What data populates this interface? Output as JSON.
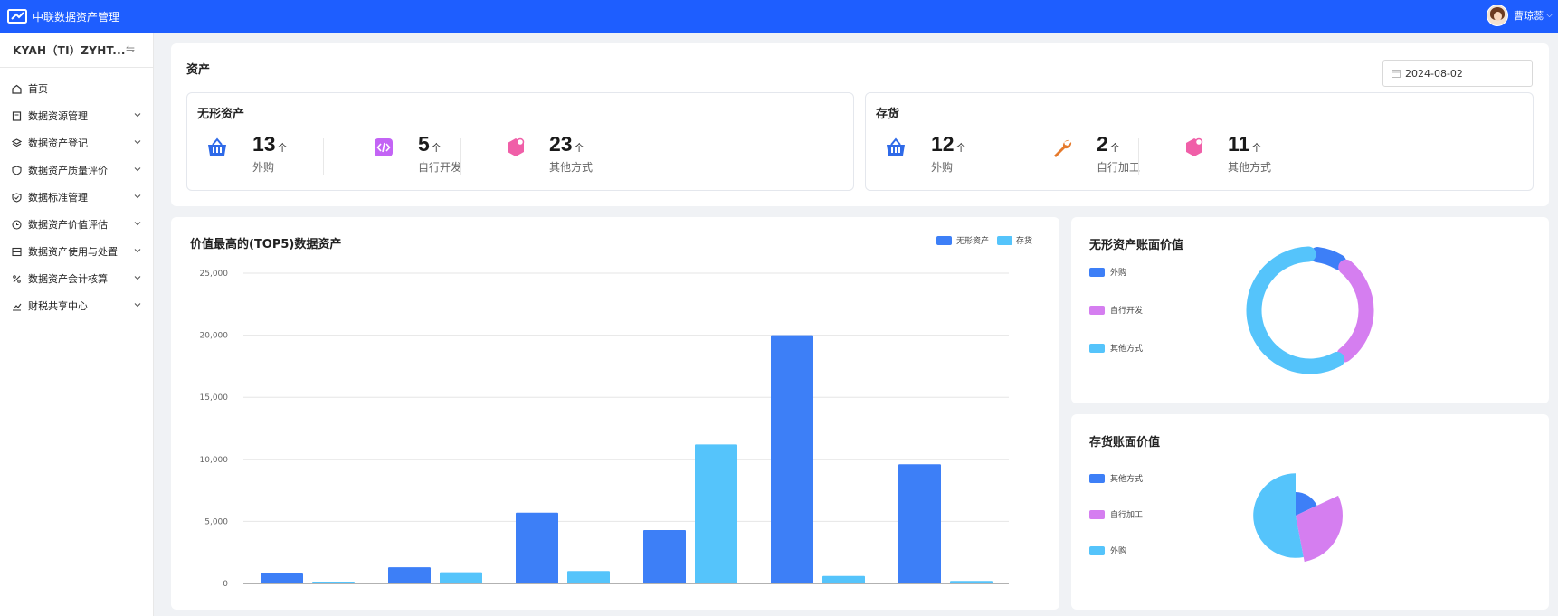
{
  "header": {
    "title": "中联数据资产管理",
    "user_name": "曹琼蕊"
  },
  "sidebar": {
    "org": "KYAH（TI）ZYHT...",
    "items": [
      {
        "label": "首页",
        "icon": "home-icon",
        "has_children": false
      },
      {
        "label": "数据资源管理",
        "icon": "book-icon",
        "has_children": true
      },
      {
        "label": "数据资产登记",
        "icon": "layers-icon",
        "has_children": true
      },
      {
        "label": "数据资产质量评价",
        "icon": "shield-icon",
        "has_children": true
      },
      {
        "label": "数据标准管理",
        "icon": "shield-check-icon",
        "has_children": true
      },
      {
        "label": "数据资产价值评估",
        "icon": "clock-icon",
        "has_children": true
      },
      {
        "label": "数据资产使用与处置",
        "icon": "archive-icon",
        "has_children": true
      },
      {
        "label": "数据资产会计核算",
        "icon": "percent-icon",
        "has_children": true
      },
      {
        "label": "财税共享中心",
        "icon": "chart-icon",
        "has_children": true
      }
    ]
  },
  "assets": {
    "title": "资产",
    "date": "2024-08-02",
    "intangible": {
      "title": "无形资产",
      "stats": [
        {
          "value": "13",
          "unit": "个",
          "label": "外购",
          "icon": "basket-icon",
          "color": "#2f6ae8"
        },
        {
          "value": "5",
          "unit": "个",
          "label": "自行开发",
          "icon": "code-icon",
          "color": "#c364f5"
        },
        {
          "value": "23",
          "unit": "个",
          "label": "其他方式",
          "icon": "hexagon-icon",
          "color": "#f05fa8"
        }
      ]
    },
    "inventory": {
      "title": "存货",
      "stats": [
        {
          "value": "12",
          "unit": "个",
          "label": "外购",
          "icon": "basket-icon",
          "color": "#2f6ae8"
        },
        {
          "value": "2",
          "unit": "个",
          "label": "自行加工",
          "icon": "wrench-icon",
          "color": "#e67a2c"
        },
        {
          "value": "11",
          "unit": "个",
          "label": "其他方式",
          "icon": "hexagon-icon",
          "color": "#f05fa8"
        }
      ]
    }
  },
  "colors": {
    "accent": "#1e5eff",
    "blue": "#3d7ff7",
    "sky": "#55c4fb",
    "purple": "#d57ef0"
  },
  "chart_data": [
    {
      "type": "bar",
      "title": "价值最高的(TOP5)数据资产",
      "categories": [
        "",
        "",
        "",
        "",
        "",
        ""
      ],
      "series": [
        {
          "name": "无形资产",
          "values": [
            800,
            1300,
            5700,
            4300,
            20000,
            9600
          ]
        },
        {
          "name": "存货",
          "values": [
            150,
            900,
            1000,
            11200,
            600,
            200
          ]
        }
      ],
      "yticks": [
        "0",
        "5,000",
        "10,000",
        "15,000",
        "20,000",
        "25,000"
      ],
      "ylim": [
        0,
        25000
      ],
      "grid": true,
      "legend": "top-right"
    },
    {
      "type": "pie",
      "variant": "donut",
      "title": "无形资产账面价值",
      "labels": [
        "外购",
        "自行开发",
        "其他方式"
      ],
      "values": [
        9,
        31,
        60
      ],
      "legend": "left"
    },
    {
      "type": "pie",
      "variant": "rose",
      "title": "存货账面价值",
      "labels": [
        "其他方式",
        "自行加工",
        "外购"
      ],
      "values": [
        18,
        29,
        53
      ],
      "radii": [
        0.5,
        1.0,
        0.9
      ],
      "legend": "left"
    }
  ]
}
